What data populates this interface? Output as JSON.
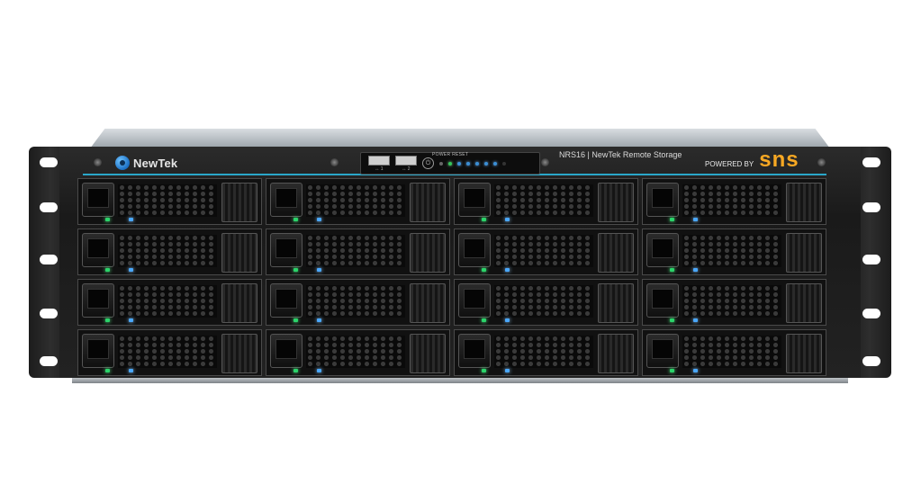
{
  "product": {
    "brand": "NewTek",
    "model_label": "NRS16 | NewTek Remote Storage",
    "powered_by_label": "POWERED BY",
    "powered_by_logo": "sns"
  },
  "control_panel": {
    "usb_ports": [
      "↔ 1",
      "↔ 2"
    ],
    "power_label": "POWER",
    "reset_label": "RESET",
    "status_leds": [
      "green",
      "blue",
      "blue",
      "blue",
      "blue",
      "blue",
      "off"
    ]
  },
  "drive_bays": {
    "rows": 4,
    "columns": 4,
    "count": 16,
    "activity_led_color": "#2bd46a",
    "power_led_color": "#4aa8ff"
  },
  "colors": {
    "sns_accent": "#f7a823",
    "teal_trim": "#2aa7c9",
    "chassis": "#1a1a1a"
  }
}
